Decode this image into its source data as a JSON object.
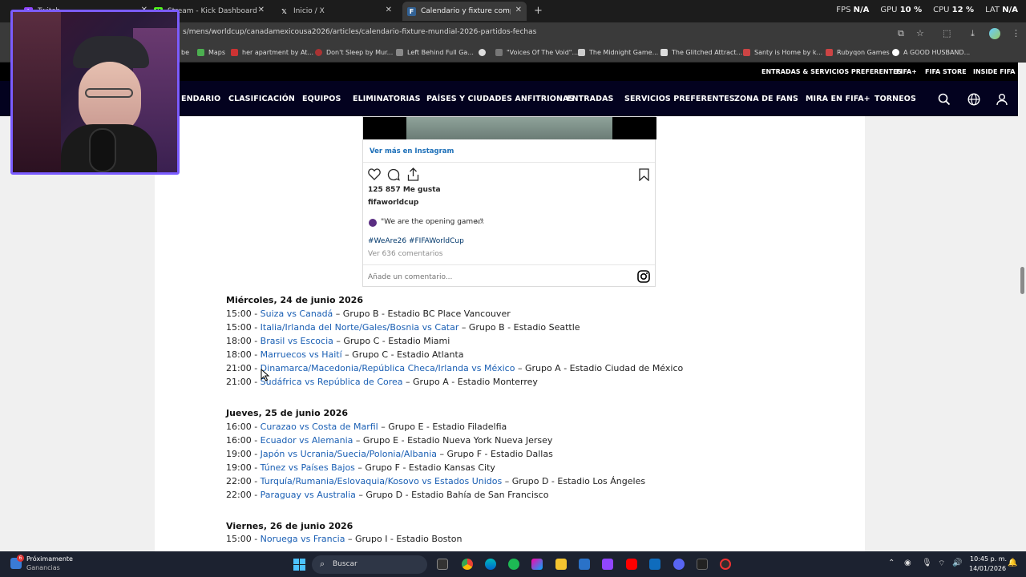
{
  "browser": {
    "tabs": [
      {
        "label": "Twitch",
        "active": false
      },
      {
        "label": "Stream - Kick Dashboard",
        "active": false
      },
      {
        "label": "Inicio / X",
        "active": false
      },
      {
        "label": "Calendario y fixture completo d",
        "active": true
      }
    ],
    "new_tab": "+",
    "stats": {
      "fps_label": "FPS",
      "fps": "N/A",
      "gpu_label": "GPU",
      "gpu": "10 %",
      "cpu_label": "CPU",
      "cpu": "12 %",
      "lat_label": "LAT",
      "lat": "N/A"
    },
    "url": "s/mens/worldcup/canadamexicousa2026/articles/calendario-fixture-mundial-2026-partidos-fechas",
    "bookmarks": [
      "be",
      "Maps",
      "her apartment by At...",
      "Don't Sleep by Mur...",
      "Left Behind Full Ga...",
      "",
      "\"Voices Of The Void\"...",
      "The Midnight Game...",
      "The Glitched Attract...",
      "Santy is Home by k...",
      "Rubyqon Games",
      "A GOOD HUSBAND..."
    ]
  },
  "fifa": {
    "top_links": [
      "ENTRADAS & SERVICIOS PREFERENTES",
      "FIFA+",
      "FIFA STORE",
      "INSIDE FIFA"
    ],
    "nav": [
      "ENDARIO",
      "CLASIFICACIÓN",
      "EQUIPOS",
      "ELIMINATORIAS",
      "PAÍSES Y CIUDADES ANFITRIONAS",
      "ENTRADAS",
      "SERVICIOS PREFERENTES",
      "ZONA DE FANS",
      "MIRA EN FIFA+",
      "TORNEOS"
    ]
  },
  "instagram": {
    "view_more": "Ver más en Instagram",
    "likes": "125 857 Me gusta",
    "account": "fifaworldcup",
    "caption": "\"We are the opening game.\"",
    "flag": "MX",
    "hashtags": "#WeAre26 #FIFAWorldCup",
    "comments": "Ver 636 comentarios",
    "comment_placeholder": "Añade un comentario..."
  },
  "schedule": [
    {
      "day": "Miércoles, 24 de junio 2026",
      "matches": [
        {
          "time": "15:00 - ",
          "match": "Suiza vs Canadá",
          "info": " – Grupo B - Estadio BC Place Vancouver"
        },
        {
          "time": "15:00 - ",
          "match": "Italia/Irlanda del Norte/Gales/Bosnia vs Catar",
          "info": " – Grupo B - Estadio Seattle"
        },
        {
          "time": "18:00 - ",
          "match": "Brasil vs Escocia",
          "info": " – Grupo C - Estadio Miami"
        },
        {
          "time": "18:00 - ",
          "match": "Marruecos vs Haití",
          "info": " – Grupo C - Estadio Atlanta"
        },
        {
          "time": "21:00 - ",
          "match": "Dinamarca/Macedonia/República Checa/Irlanda vs México",
          "info": " – Grupo A - Estadio Ciudad de México"
        },
        {
          "time": "21:00 - ",
          "match": "Sudáfrica vs República de Corea",
          "info": " – Grupo A - Estadio Monterrey"
        }
      ]
    },
    {
      "day": "Jueves, 25 de junio 2026",
      "matches": [
        {
          "time": "16:00 - ",
          "match": "Curazao vs Costa de Marfil",
          "info": " – Grupo E - Estadio Filadelfia"
        },
        {
          "time": "16:00 - ",
          "match": "Ecuador vs Alemania",
          "info": " – Grupo E - Estadio Nueva York Nueva Jersey"
        },
        {
          "time": "19:00 - ",
          "match": "Japón vs Ucrania/Suecia/Polonia/Albania",
          "info": " – Grupo F - Estadio Dallas"
        },
        {
          "time": "19:00 - ",
          "match": "Túnez vs Países Bajos",
          "info": " – Grupo F - Estadio Kansas City"
        },
        {
          "time": "22:00 - ",
          "match": "Turquía/Rumania/Eslovaquia/Kosovo vs Estados Unidos",
          "info": " – Grupo D - Estadio Los Ángeles"
        },
        {
          "time": "22:00 - ",
          "match": "Paraguay vs Australia",
          "info": " – Grupo D - Estadio Bahía de San Francisco"
        }
      ]
    },
    {
      "day": "Viernes, 26 de junio 2026",
      "matches": [
        {
          "time": "15:00 - ",
          "match": "Noruega vs Francia",
          "info": " – Grupo I - Estadio Boston"
        }
      ]
    }
  ],
  "taskbar": {
    "weather_badge": "6",
    "weather_title": "Próximamente",
    "weather_sub": "Ganancias",
    "search": "Buscar",
    "time": "10:45 p. m.",
    "date": "14/01/2026"
  }
}
